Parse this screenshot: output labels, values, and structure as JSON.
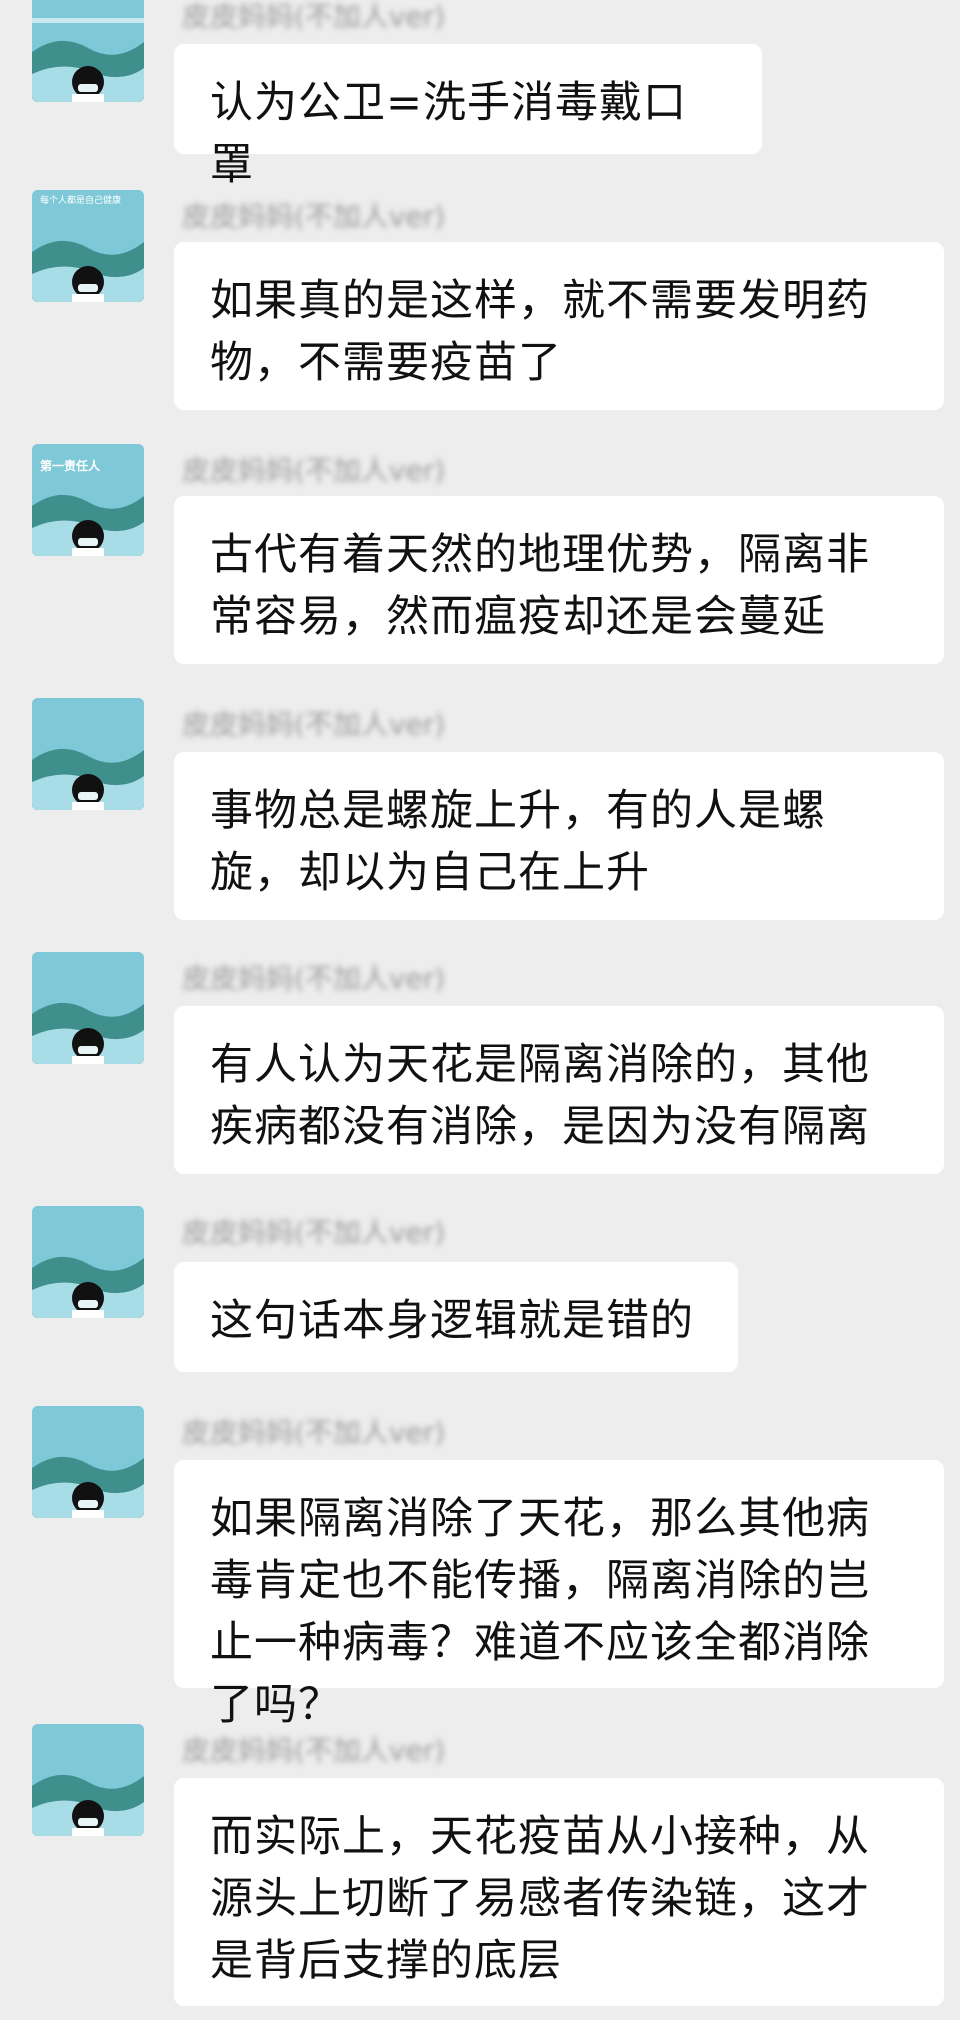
{
  "sender_name": "皮皮妈妈(不加人ver)",
  "avatar": {
    "icon": "masked-child-avatar-icon",
    "badge_line1": "每个人都是自己健康",
    "badge_line2": "第一责任人",
    "bg_color": "#7ec8d8"
  },
  "colors": {
    "background": "#ededed",
    "bubble": "#ffffff",
    "text": "#111111"
  },
  "messages": [
    {
      "text": "认为公卫=洗手消毒戴口罩"
    },
    {
      "text": "如果真的是这样，就不需要发明药物，不需要疫苗了"
    },
    {
      "text": "古代有着天然的地理优势，隔离非常容易，然而瘟疫却还是会蔓延"
    },
    {
      "text": "事物总是螺旋上升，有的人是螺旋，却以为自己在上升"
    },
    {
      "text": "有人认为天花是隔离消除的，其他疾病都没有消除，是因为没有隔离"
    },
    {
      "text": "这句话本身逻辑就是错的"
    },
    {
      "text": "如果隔离消除了天花，那么其他病毒肯定也不能传播，隔离消除的岂止一种病毒？难道不应该全都消除了吗？"
    },
    {
      "text": "而实际上，天花疫苗从小接种，从源头上切断了易感者传染链，这才是背后支撑的底层"
    }
  ]
}
